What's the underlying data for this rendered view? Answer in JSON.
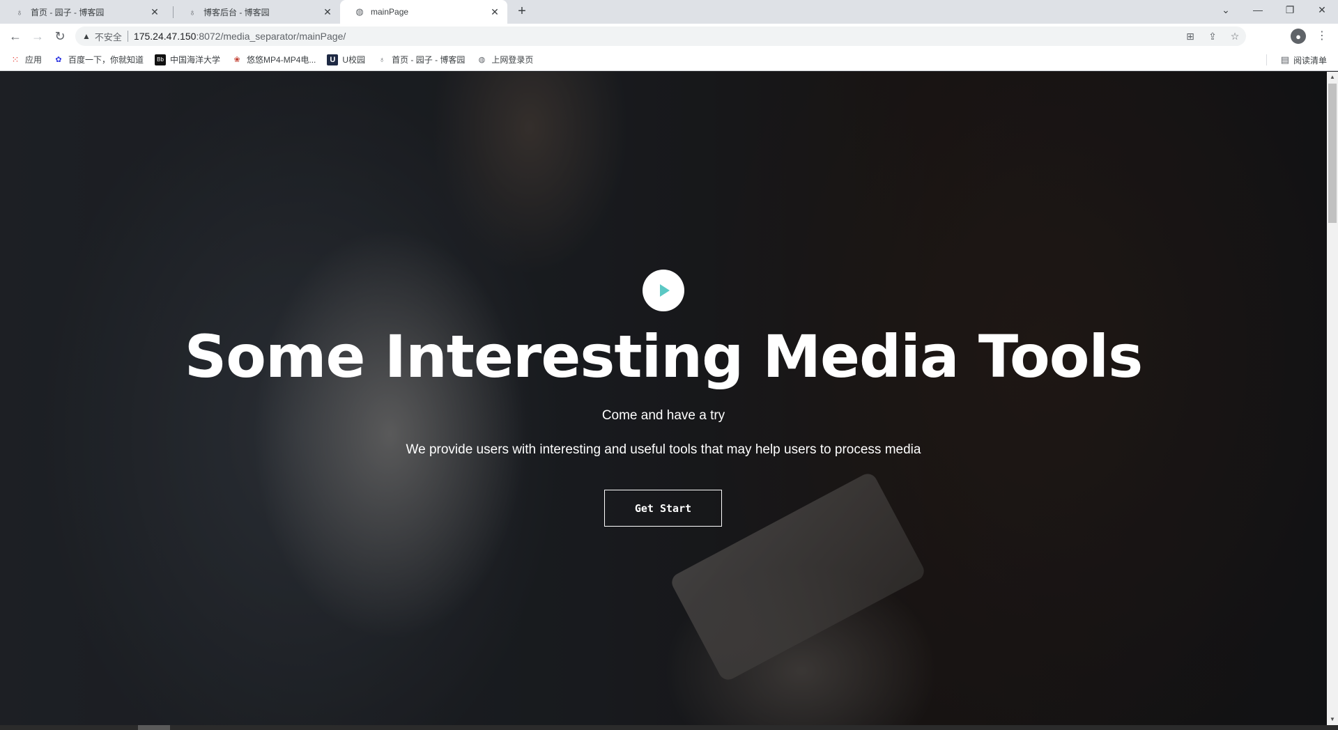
{
  "browser": {
    "tabs": [
      {
        "title": "首页 - 园子 - 博客园",
        "favicon": "cnblogs-icon",
        "active": false
      },
      {
        "title": "博客后台 - 博客园",
        "favicon": "cnblogs-icon",
        "active": false
      },
      {
        "title": "mainPage",
        "favicon": "globe-icon",
        "active": true
      }
    ],
    "new_tab": "+",
    "address": {
      "security_label": "不安全",
      "host": "175.24.47.150",
      "path": ":8072/media_separator/mainPage/"
    },
    "bookmarks": [
      {
        "label": "应用",
        "icon": "apps-grid-icon"
      },
      {
        "label": "百度一下，你就知道",
        "icon": "baidu-paw-icon"
      },
      {
        "label": "中国海洋大学",
        "icon": "ouc-icon"
      },
      {
        "label": "悠悠MP4-MP4电...",
        "icon": "yoyo-icon"
      },
      {
        "label": "U校园",
        "icon": "u-campus-icon"
      },
      {
        "label": "首页 - 园子 - 博客园",
        "icon": "cnblogs-icon"
      },
      {
        "label": "上网登录页",
        "icon": "globe-icon"
      }
    ],
    "reading_list": "阅读清单"
  },
  "hero": {
    "title": "Some Interesting Media Tools",
    "subtitle": "Come and have a try",
    "description": "We provide users with interesting and useful tools that may help users to process media",
    "cta_label": "Get Start",
    "play_color": "#5bc8c4"
  }
}
